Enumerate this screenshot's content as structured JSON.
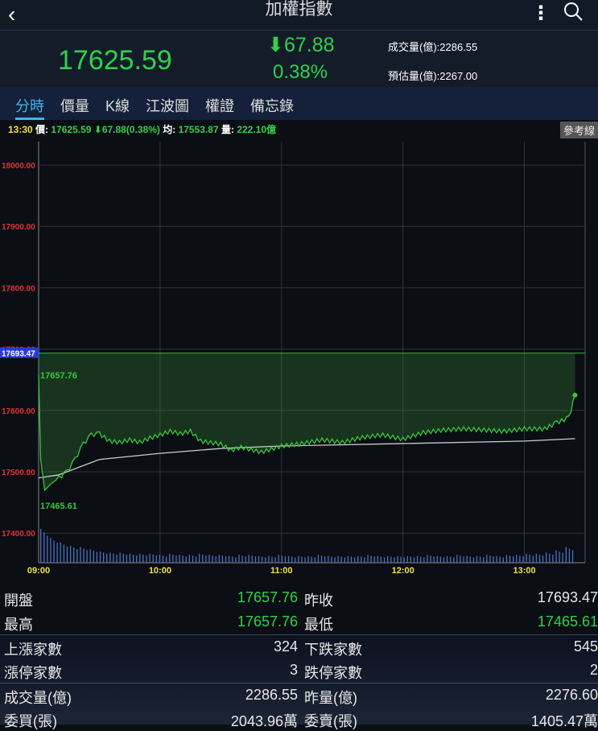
{
  "header": {
    "title": "加權指數",
    "back": "‹",
    "more": "⋮"
  },
  "quote": {
    "price": "17625.59",
    "change": "⬇67.88",
    "percent": "0.38%",
    "volume": "成交量(億):2286.55",
    "est_volume": "預估量(億):2267.00"
  },
  "tabs": [
    "分時",
    "價量",
    "K線",
    "江波圖",
    "權證",
    "備忘錄"
  ],
  "infobar": {
    "time": "13:30",
    "price_label": "價:",
    "price": "17625.59 ⬇67.88(0.38%)",
    "avg_label": "均:",
    "avg": "17553.87",
    "vol_label": "量:",
    "vol": "222.10億",
    "ref_button": "參考線"
  },
  "chart_data": {
    "type": "line",
    "y_ticks": [
      "18000.00",
      "17900.00",
      "17800.00",
      "17700.00",
      "17600.00",
      "17500.00",
      "17400.00"
    ],
    "x_ticks": [
      "09:00",
      "10:00",
      "11:00",
      "12:00",
      "13:00"
    ],
    "ylim": [
      17400,
      18000
    ],
    "prev_close": 17693.47,
    "prev_close_label": "17693.47",
    "high_label": "17657.76",
    "low_label": "17465.61",
    "price": [
      [
        0,
        17657
      ],
      [
        1,
        17520
      ],
      [
        3,
        17470
      ],
      [
        6,
        17480
      ],
      [
        10,
        17490
      ],
      [
        14,
        17500
      ],
      [
        18,
        17520
      ],
      [
        22,
        17545
      ],
      [
        26,
        17560
      ],
      [
        30,
        17562
      ],
      [
        35,
        17550
      ],
      [
        40,
        17548
      ],
      [
        45,
        17552
      ],
      [
        50,
        17548
      ],
      [
        55,
        17555
      ],
      [
        60,
        17560
      ],
      [
        65,
        17566
      ],
      [
        70,
        17562
      ],
      [
        75,
        17566
      ],
      [
        80,
        17550
      ],
      [
        90,
        17545
      ],
      [
        95,
        17535
      ],
      [
        100,
        17540
      ],
      [
        110,
        17532
      ],
      [
        120,
        17542
      ],
      [
        130,
        17546
      ],
      [
        140,
        17552
      ],
      [
        150,
        17548
      ],
      [
        160,
        17556
      ],
      [
        170,
        17560
      ],
      [
        180,
        17553
      ],
      [
        190,
        17564
      ],
      [
        200,
        17568
      ],
      [
        210,
        17570
      ],
      [
        220,
        17568
      ],
      [
        230,
        17566
      ],
      [
        240,
        17570
      ],
      [
        250,
        17570
      ],
      [
        256,
        17580
      ],
      [
        262,
        17588
      ],
      [
        265,
        17625
      ]
    ],
    "average": [
      [
        0,
        17490
      ],
      [
        10,
        17495
      ],
      [
        30,
        17520
      ],
      [
        60,
        17530
      ],
      [
        90,
        17538
      ],
      [
        120,
        17542
      ],
      [
        180,
        17546
      ],
      [
        240,
        17550
      ],
      [
        265,
        17554
      ]
    ],
    "volume": [
      30,
      22,
      18,
      15,
      14,
      12,
      10,
      9,
      9,
      8,
      8,
      8,
      7,
      8,
      7,
      7,
      8,
      7,
      7,
      6,
      7,
      7,
      6,
      6,
      7,
      6,
      6,
      6,
      7,
      6,
      6,
      6,
      6,
      7,
      6,
      6,
      6,
      6,
      6,
      7,
      6,
      6,
      7,
      6,
      6,
      7,
      6,
      7,
      7,
      8,
      8,
      9,
      11,
      14
    ]
  },
  "stats": [
    {
      "l1": "開盤",
      "v1": "17657.76",
      "l2": "昨收",
      "v2": "17693.47",
      "g1": true,
      "g2": false
    },
    {
      "l1": "最高",
      "v1": "17657.76",
      "l2": "最低",
      "v2": "17465.61",
      "g1": true,
      "g2": true
    },
    {
      "l1": "上漲家數",
      "v1": "324",
      "l2": "下跌家數",
      "v2": "545",
      "sep": true
    },
    {
      "l1": "漲停家數",
      "v1": "3",
      "l2": "跌停家數",
      "v2": "2"
    },
    {
      "l1": "成交量(億)",
      "v1": "2286.55",
      "l2": "昨量(億)",
      "v2": "2276.60",
      "sep": true
    },
    {
      "l1": "委買(張)",
      "v1": "2043.96萬",
      "l2": "委賣(張)",
      "v2": "1405.47萬"
    }
  ]
}
